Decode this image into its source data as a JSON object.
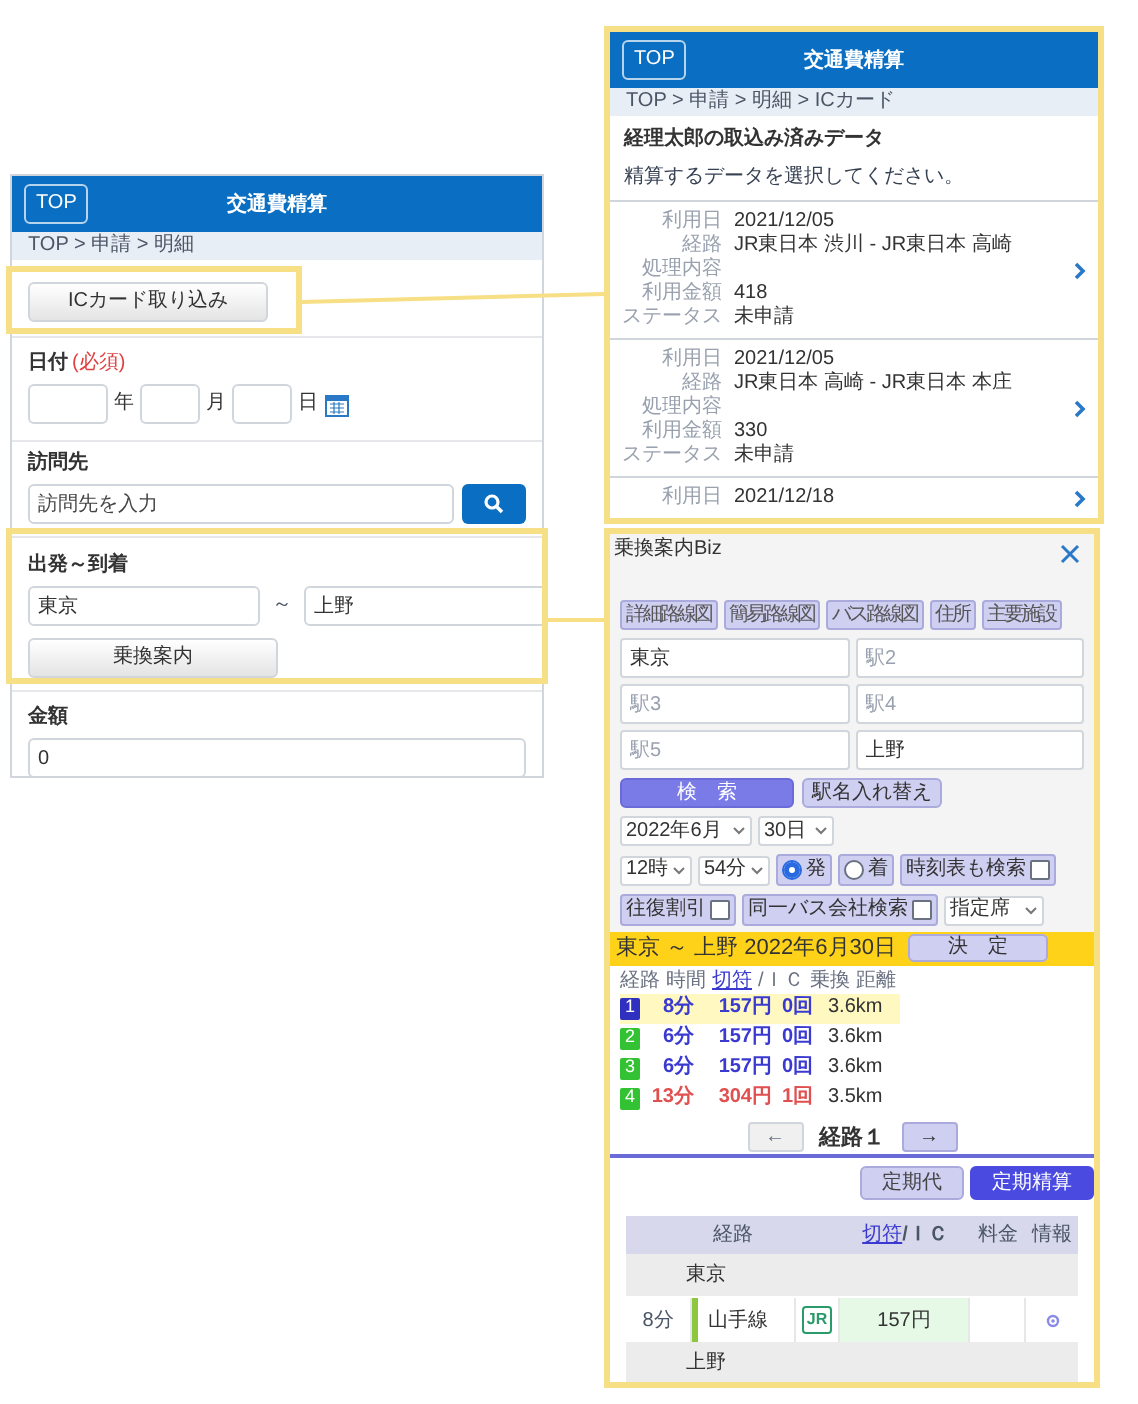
{
  "detail_screen": {
    "header": {
      "top_button": "TOP",
      "title": "交通費精算"
    },
    "breadcrumb": "TOP > 申請 > 明細",
    "ic_button": "ICカード取り込み",
    "date": {
      "label": "日付",
      "required": "(必須)",
      "units": [
        "年",
        "月",
        "日"
      ]
    },
    "visit": {
      "label": "訪問先",
      "placeholder": "訪問先を入力"
    },
    "route": {
      "label": "出発～到着",
      "from": "東京",
      "separator": "～",
      "to": "上野",
      "button": "乗換案内"
    },
    "amount": {
      "label": "金額",
      "value": "0"
    }
  },
  "ic_screen": {
    "header": {
      "top_button": "TOP",
      "title": "交通費精算"
    },
    "breadcrumb": "TOP > 申請 > 明細 > ICカード",
    "title": "経理太郎の取込み済みデータ",
    "instruction": "精算するデータを選択してください。",
    "records": [
      {
        "fields": [
          {
            "label": "利用日",
            "value": "2021/12/05"
          },
          {
            "label": "経路",
            "value": "JR東日本 渋川 - JR東日本 高崎"
          },
          {
            "label": "処理内容"
          },
          {
            "label": "利用金額",
            "value": "418"
          },
          {
            "label": "ステータス",
            "value": "未申請"
          }
        ]
      },
      {
        "fields": [
          {
            "label": "利用日",
            "value": "2021/12/05"
          },
          {
            "label": "経路",
            "value": "JR東日本 高崎 - JR東日本 本庄"
          },
          {
            "label": "処理内容"
          },
          {
            "label": "利用金額",
            "value": "330"
          },
          {
            "label": "ステータス",
            "value": "未申請"
          }
        ]
      },
      {
        "fields": [
          {
            "label": "利用日",
            "value": "2021/12/18"
          }
        ]
      }
    ]
  },
  "transit_screen": {
    "title": "乗換案内Biz",
    "map_buttons": [
      "詳細路線図",
      "簡易路線図",
      "バス路線図",
      "住所",
      "主要施設"
    ],
    "stations": [
      {
        "value": "東京"
      },
      {
        "placeholder": "駅2"
      },
      {
        "placeholder": "駅3"
      },
      {
        "placeholder": "駅4"
      },
      {
        "placeholder": "駅5"
      },
      {
        "value": "上野"
      }
    ],
    "search_button": "検　索",
    "swap_button": "駅名入れ替え",
    "month": "2022年6月",
    "day": "30日",
    "hour": "12時",
    "minute": "54分",
    "modes": [
      {
        "label": "発",
        "selected": true
      },
      {
        "label": "着",
        "selected": false
      }
    ],
    "options": [
      {
        "label": "時刻表も検索",
        "checked": false
      },
      {
        "label": "往復割引",
        "checked": false
      },
      {
        "label": "同一バス会社検索",
        "checked": false
      }
    ],
    "seat": "指定席",
    "result": {
      "summary": "東京 ～ 上野 2022年6月30日",
      "decide_button": "決　定",
      "columns": [
        {
          "label": "経路",
          "kind": "text"
        },
        {
          "label": "時間",
          "kind": "text"
        },
        {
          "label": "切符",
          "kind": "link"
        },
        {
          "label": "/ＩＣ",
          "kind": "text"
        },
        {
          "label": "乗換",
          "kind": "text"
        },
        {
          "label": "距離",
          "kind": "text"
        }
      ],
      "routes": [
        {
          "number": "1",
          "time": "8分",
          "fare": "157円",
          "transfers": "0回",
          "distance": "3.6km",
          "selected": true,
          "color": "#3a3ad0"
        },
        {
          "number": "2",
          "time": "6分",
          "fare": "157円",
          "transfers": "0回",
          "distance": "3.6km",
          "selected": false,
          "color": "#3a3ad0"
        },
        {
          "number": "3",
          "time": "6分",
          "fare": "157円",
          "transfers": "0回",
          "distance": "3.6km",
          "selected": false,
          "color": "#3a3ad0"
        },
        {
          "number": "4",
          "time": "13分",
          "fare": "304円",
          "transfers": "1回",
          "distance": "3.5km",
          "selected": false,
          "color": "#e05050"
        }
      ]
    },
    "nav": {
      "prev": "←",
      "label": "経路１",
      "next": "→"
    },
    "pass_buttons": [
      {
        "label": "定期代",
        "selected": false
      },
      {
        "label": "定期精算",
        "selected": true
      }
    ],
    "detail_table": {
      "columns": [
        {
          "label": "経路",
          "kind": "text"
        },
        {
          "label": "切符",
          "kind": "link"
        },
        {
          "label": "/ＩＣ",
          "kind": "text"
        },
        {
          "label": "料金",
          "kind": "text"
        },
        {
          "label": "情報",
          "kind": "text"
        }
      ],
      "rows": [
        {
          "kind": "station",
          "name": "東京"
        },
        {
          "kind": "segment",
          "time": "8分",
          "line": "山手線",
          "operator": "JR",
          "fare": "157円"
        },
        {
          "kind": "station",
          "name": "上野"
        }
      ]
    }
  }
}
